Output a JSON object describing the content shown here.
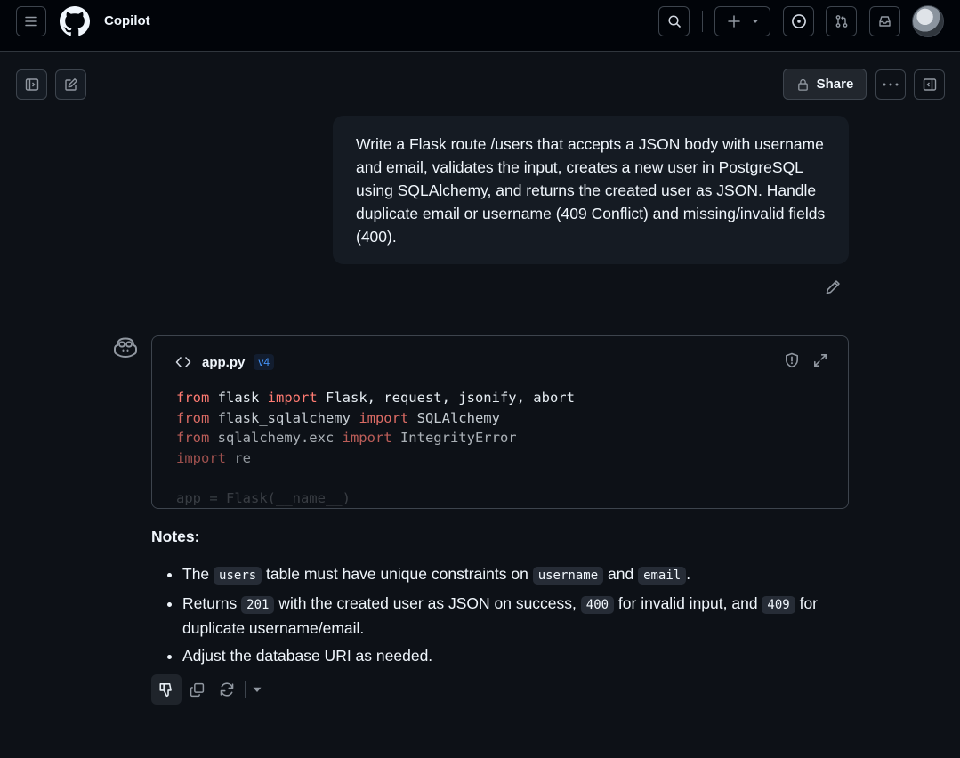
{
  "header": {
    "title": "Copilot"
  },
  "toolbar": {
    "share_label": "Share"
  },
  "conversation": {
    "user_message": " Write a Flask route /users that accepts a JSON body with username and email, validates the input, creates a new user in PostgreSQL using SQLAlchemy, and returns the created user as JSON. Handle duplicate email or username (409 Conflict) and missing/invalid fields (400).",
    "code_card": {
      "filename": "app.py",
      "version": "v4",
      "lines": {
        "l1": {
          "k1": "from",
          "a": " flask ",
          "k2": "import",
          "b": " Flask, request, jsonify, abort"
        },
        "l2": {
          "k1": "from",
          "a": " flask_sqlalchemy ",
          "k2": "import",
          "b": " SQLAlchemy"
        },
        "l3": {
          "k1": "from",
          "a": " sqlalchemy.exc ",
          "k2": "import",
          "b": " IntegrityError"
        },
        "l4": {
          "k1": "import",
          "a": " re"
        },
        "l6": {
          "text": "app = Flask(__name__)"
        }
      }
    },
    "notes": {
      "title": "Notes:",
      "n1": {
        "a": "The ",
        "c1": "users",
        "b": " table must have unique constraints on ",
        "c2": "username",
        "c": " and ",
        "c3": "email",
        "d": "."
      },
      "n2": {
        "a": "Returns ",
        "c1": "201",
        "b": " with the created user as JSON on success, ",
        "c2": "400",
        "c": " for invalid input, and ",
        "c3": "409",
        "d": " for duplicate username/email."
      },
      "n3": {
        "a": "Adjust the database URI as needed."
      }
    }
  },
  "icons": {
    "menu": "menu-icon",
    "logo": "github-logo-icon",
    "search": "search-icon",
    "plus": "plus-icon",
    "issues": "issue-opened-icon",
    "pulls": "git-pull-request-icon",
    "inbox": "inbox-icon",
    "sidebar": "sidebar-toggle-icon",
    "new_chat": "new-chat-icon",
    "lock": "lock-icon",
    "kebab": "kebab-horizontal-icon",
    "pencil": "pencil-icon",
    "copilot": "copilot-icon",
    "code": "code-icon",
    "shield": "shield-icon",
    "expand": "expand-icon",
    "thumbs_down": "thumbs-down-icon",
    "copy": "copy-icon",
    "retry": "sync-icon",
    "caret": "triangle-down-icon"
  },
  "colors": {
    "background": "#0d1117",
    "header": "#010409",
    "bubble": "#151b23",
    "keyword": "#ff7b72",
    "accent": "#4493f8"
  }
}
